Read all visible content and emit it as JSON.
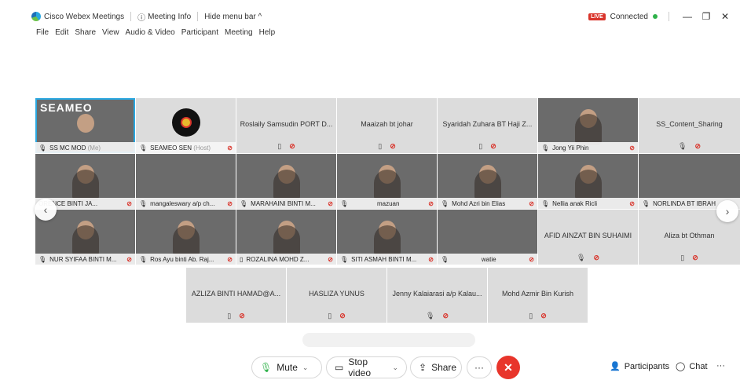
{
  "titlebar": {
    "app_name": "Cisco Webex Meetings",
    "meeting_info": "Meeting Info",
    "hide_menu": "Hide menu bar ^",
    "live": "LIVE",
    "connected": "Connected",
    "minimize": "—",
    "restore": "❐",
    "close": "✕"
  },
  "menu": [
    "File",
    "Edit",
    "Share",
    "View",
    "Audio & Video",
    "Participant",
    "Meeting",
    "Help"
  ],
  "participants": [
    {
      "name": "SS MC MOD",
      "sub": "(Me)",
      "muted": false
    },
    {
      "name": "SEAMEO SEN",
      "sub": "(Host)",
      "muted": true
    },
    {
      "name": "Roslaily Samsudin PORT D..."
    },
    {
      "name": "Maaizah bt johar"
    },
    {
      "name": "Syaridah Zuhara BT Haji Z..."
    },
    {
      "name": "Jong Yii Phin",
      "muted": true
    },
    {
      "name": "SS_Content_Sharing"
    },
    {
      "name": "ORENCE BINTI JA...",
      "muted": true
    },
    {
      "name": "mangaleswary a/p ch...",
      "muted": true
    },
    {
      "name": "MARAHAINI BINTI M...",
      "muted": true
    },
    {
      "name": "mazuan",
      "muted": true
    },
    {
      "name": "Mohd Azri bin Elias",
      "muted": true
    },
    {
      "name": "Nellia anak Ricli",
      "muted": true
    },
    {
      "name": "NORLINDA BT IBRAH"
    },
    {
      "name": "NUR SYIFAA BINTI M...",
      "muted": true
    },
    {
      "name": "Ros Ayu binti Ab. Raj...",
      "muted": true
    },
    {
      "name": "ROZALINA MOHD Z...",
      "muted": true
    },
    {
      "name": "SITI ASMAH BINTI M...",
      "muted": true
    },
    {
      "name": "watie",
      "muted": true
    },
    {
      "name": "AFID AINZAT BIN SUHAIMI"
    },
    {
      "name": "Aliza bt Othman"
    },
    {
      "name": "AZLIZA BINTI HAMAD@A..."
    },
    {
      "name": "HASLIZA YUNUS"
    },
    {
      "name": "Jenny Kalaiarasi a/p Kalau..."
    },
    {
      "name": "Mohd Azmir Bin Kurish"
    }
  ],
  "banner_text": "SEAMEO",
  "icons": {
    "mic": "mic-icon",
    "mic_muted": "mic-muted-icon",
    "phone": "phone-icon",
    "camera": "camera-icon"
  },
  "toolbar": {
    "mute": "Mute",
    "stop_video": "Stop video",
    "share": "Share",
    "more": "···",
    "participants": "Participants",
    "chat": "Chat",
    "overflow": "···"
  },
  "colors": {
    "accent": "#2aa7e0",
    "end_call": "#e8352b",
    "muted": "#d9342b",
    "connected": "#2fb24a"
  }
}
